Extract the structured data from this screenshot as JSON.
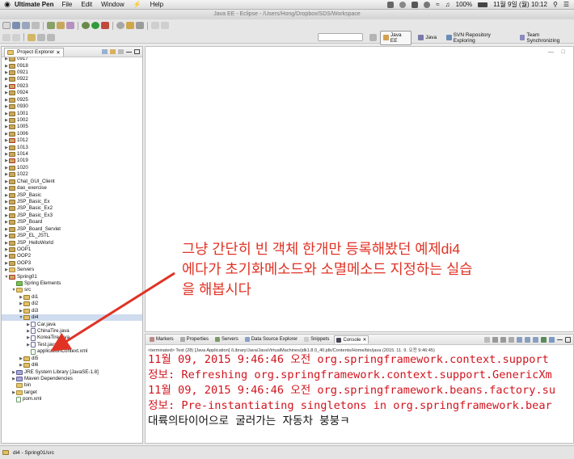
{
  "menubar": {
    "apple": "",
    "app_name": "Ultimate Pen",
    "items": [
      "File",
      "Edit",
      "Window",
      "Help"
    ],
    "battery": "100%",
    "datetime": "11월 9일 (월)  10:12"
  },
  "window": {
    "title": "Java EE - Eclipse - /Users/Hong/Dropbox/SDS/Workspace"
  },
  "perspectives": [
    {
      "label": "Java EE",
      "active": true
    },
    {
      "label": "Java",
      "active": false
    },
    {
      "label": "SVN Repository Exploring",
      "active": false
    },
    {
      "label": "Team Synchronizing",
      "active": false
    }
  ],
  "project_explorer": {
    "tab_label": "Project Explorer",
    "items": [
      {
        "label": "0917",
        "icon": "folder-project-icon",
        "depth": 0,
        "expanded": false
      },
      {
        "label": "0918",
        "icon": "folder-project-icon",
        "depth": 0,
        "expanded": false
      },
      {
        "label": "0921",
        "icon": "folder-project-icon",
        "depth": 0,
        "expanded": false
      },
      {
        "label": "0922",
        "icon": "folder-project-icon",
        "depth": 0,
        "expanded": false
      },
      {
        "label": "0923",
        "icon": "folder-project-error-icon",
        "depth": 0,
        "expanded": false
      },
      {
        "label": "0924",
        "icon": "folder-project-icon",
        "depth": 0,
        "expanded": false
      },
      {
        "label": "0925",
        "icon": "folder-project-icon",
        "depth": 0,
        "expanded": false
      },
      {
        "label": "0930",
        "icon": "folder-project-icon",
        "depth": 0,
        "expanded": false
      },
      {
        "label": "1001",
        "icon": "folder-project-icon",
        "depth": 0,
        "expanded": false
      },
      {
        "label": "1002",
        "icon": "folder-project-icon",
        "depth": 0,
        "expanded": false
      },
      {
        "label": "1005",
        "icon": "folder-project-icon",
        "depth": 0,
        "expanded": false
      },
      {
        "label": "1006",
        "icon": "folder-project-icon",
        "depth": 0,
        "expanded": false
      },
      {
        "label": "1012",
        "icon": "folder-project-error-icon",
        "depth": 0,
        "expanded": false
      },
      {
        "label": "1013",
        "icon": "folder-project-icon",
        "depth": 0,
        "expanded": false
      },
      {
        "label": "1014",
        "icon": "folder-project-icon",
        "depth": 0,
        "expanded": false
      },
      {
        "label": "1019",
        "icon": "folder-project-error-icon",
        "depth": 0,
        "expanded": false
      },
      {
        "label": "1020",
        "icon": "folder-project-icon",
        "depth": 0,
        "expanded": false
      },
      {
        "label": "1022",
        "icon": "folder-project-icon",
        "depth": 0,
        "expanded": false
      },
      {
        "label": "Chat_GUI_Client",
        "icon": "folder-project-icon",
        "depth": 0,
        "expanded": false
      },
      {
        "label": "dao_exercise",
        "icon": "folder-project-icon",
        "depth": 0,
        "expanded": false
      },
      {
        "label": "JSP_Basic",
        "icon": "folder-project-icon",
        "depth": 0,
        "expanded": false
      },
      {
        "label": "JSP_Basic_Ex",
        "icon": "folder-project-icon",
        "depth": 0,
        "expanded": false
      },
      {
        "label": "JSP_Basic_Ex2",
        "icon": "folder-project-icon",
        "depth": 0,
        "expanded": false
      },
      {
        "label": "JSP_Basic_Ex3",
        "icon": "folder-project-icon",
        "depth": 0,
        "expanded": false
      },
      {
        "label": "JSP_Board",
        "icon": "folder-project-icon",
        "depth": 0,
        "expanded": false
      },
      {
        "label": "JSP_Board_Servlet",
        "icon": "folder-project-icon",
        "depth": 0,
        "expanded": false
      },
      {
        "label": "JSP_EL_JSTL",
        "icon": "folder-project-icon",
        "depth": 0,
        "expanded": false
      },
      {
        "label": "JSP_HelloWorld",
        "icon": "folder-project-icon",
        "depth": 0,
        "expanded": false
      },
      {
        "label": "OOP1",
        "icon": "folder-project-icon",
        "depth": 0,
        "expanded": false
      },
      {
        "label": "OOP2",
        "icon": "folder-project-icon",
        "depth": 0,
        "expanded": false
      },
      {
        "label": "OOP3",
        "icon": "folder-project-icon",
        "depth": 0,
        "expanded": false
      },
      {
        "label": "Servers",
        "icon": "folder-icon",
        "depth": 0,
        "expanded": false
      },
      {
        "label": "Spring01",
        "icon": "folder-project-error-icon",
        "depth": 0,
        "expanded": true
      },
      {
        "label": "Spring Elements",
        "icon": "spring-icon",
        "depth": 1,
        "expanded": null
      },
      {
        "label": "src",
        "icon": "folder-icon",
        "depth": 1,
        "expanded": true
      },
      {
        "label": "di1",
        "icon": "package-icon",
        "depth": 2,
        "expanded": false
      },
      {
        "label": "di2",
        "icon": "package-icon",
        "depth": 2,
        "expanded": false
      },
      {
        "label": "di3",
        "icon": "package-icon",
        "depth": 2,
        "expanded": false
      },
      {
        "label": "di4",
        "icon": "package-icon",
        "depth": 2,
        "expanded": true,
        "selected": true
      },
      {
        "label": "Car.java",
        "icon": "java-file-icon",
        "depth": 3,
        "expanded": false
      },
      {
        "label": "ChinaTire.java",
        "icon": "java-file-icon",
        "depth": 3,
        "expanded": false
      },
      {
        "label": "KoreaTire.java",
        "icon": "java-file-icon",
        "depth": 3,
        "expanded": false
      },
      {
        "label": "Test.java",
        "icon": "java-file-icon",
        "depth": 3,
        "expanded": false
      },
      {
        "label": "applicationContext.xml",
        "icon": "xml-file-icon",
        "depth": 3,
        "expanded": null
      },
      {
        "label": "di5",
        "icon": "package-icon",
        "depth": 2,
        "expanded": false
      },
      {
        "label": "di6",
        "icon": "package-icon",
        "depth": 2,
        "expanded": false
      },
      {
        "label": "JRE System Library [JavaSE-1.8]",
        "icon": "library-icon",
        "depth": 1,
        "expanded": false
      },
      {
        "label": "Maven Dependencies",
        "icon": "library-icon",
        "depth": 1,
        "expanded": false
      },
      {
        "label": "bin",
        "icon": "folder-icon",
        "depth": 1,
        "expanded": null
      },
      {
        "label": "target",
        "icon": "folder-icon",
        "depth": 1,
        "expanded": false
      },
      {
        "label": "pom.xml",
        "icon": "xml-file-icon",
        "depth": 1,
        "expanded": null
      }
    ]
  },
  "console": {
    "tabs": [
      {
        "label": "Markers",
        "icon": "markers-icon",
        "active": false
      },
      {
        "label": "Properties",
        "icon": "properties-icon",
        "active": false
      },
      {
        "label": "Servers",
        "icon": "servers-icon",
        "active": false
      },
      {
        "label": "Data Source Explorer",
        "icon": "data-source-icon",
        "active": false
      },
      {
        "label": "Snippets",
        "icon": "snippets-icon",
        "active": false
      },
      {
        "label": "Console",
        "icon": "console-icon",
        "active": true
      }
    ],
    "terminated_line": "<terminated> Test (28) [Java Application] /Library/Java/JavaVirtualMachines/jdk1.8.0_40.jdk/Contents/Home/bin/java (2015. 11. 9. 오전 9:46:45)",
    "lines": [
      {
        "text": "11월 09, 2015 9:46:46 오전 org.springframework.context.support",
        "color": "red"
      },
      {
        "text": "정보: Refreshing org.springframework.context.support.GenericXm",
        "color": "red"
      },
      {
        "text": "11월 09, 2015 9:46:46 오전 org.springframework.beans.factory.su",
        "color": "red"
      },
      {
        "text": "정보: Pre-instantiating singletons in org.springframework.bear",
        "color": "red"
      },
      {
        "text": "대륙의타이어으로 굴러가는 자동차 붕붕ㅋ",
        "color": "black"
      }
    ]
  },
  "status_bar": {
    "text": "di4 - Spring01/src"
  },
  "annotation": {
    "lines": [
      "그냥 간단히 빈 객체 한개만 등록해봤던 예제di4",
      "에다가 초기화메소드와 소멸메소드 지정하는 실습",
      "을 해봅시다"
    ]
  },
  "colors": {
    "annotation": "#e03325",
    "console_error": "#d2141e",
    "selection": "#cfdcef"
  }
}
